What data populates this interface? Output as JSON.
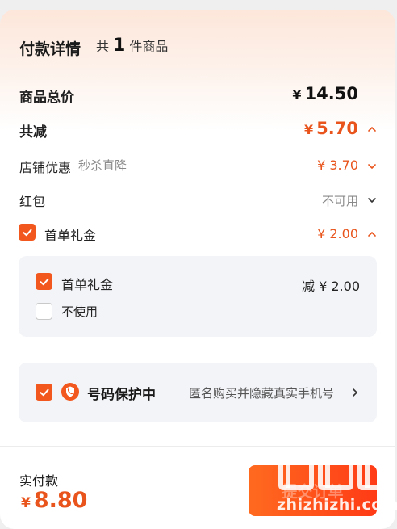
{
  "header": {
    "title": "付款详情",
    "count_prefix": "共",
    "count": "1",
    "count_suffix": "件商品"
  },
  "summary": {
    "total_label": "商品总价",
    "total_currency": "¥",
    "total_value": "14.50",
    "reduce_label": "共减",
    "reduce_currency": "¥",
    "reduce_value": "5.70"
  },
  "discounts": {
    "shop_label": "店铺优惠",
    "shop_tag": "秒杀直降",
    "shop_value": "¥ 3.70",
    "redpacket_label": "红包",
    "redpacket_value": "不可用",
    "first_order_label": "首单礼金",
    "first_order_value": "¥ 2.00"
  },
  "first_order_options": {
    "option1_label": "首单礼金",
    "option1_value": "减 ¥ 2.00",
    "option2_label": "不使用"
  },
  "privacy": {
    "label": "号码保护中",
    "desc": "匿名购买并隐藏真实手机号"
  },
  "footer": {
    "pay_label": "实付款",
    "pay_currency": "¥",
    "pay_value": "8.80",
    "submit_label": "提交订单"
  },
  "watermark": {
    "text": "zhizhizhi.com"
  },
  "colors": {
    "accent": "#e8541c",
    "checkbox": "#f2581e",
    "panel_bg": "#f3f4f8"
  }
}
